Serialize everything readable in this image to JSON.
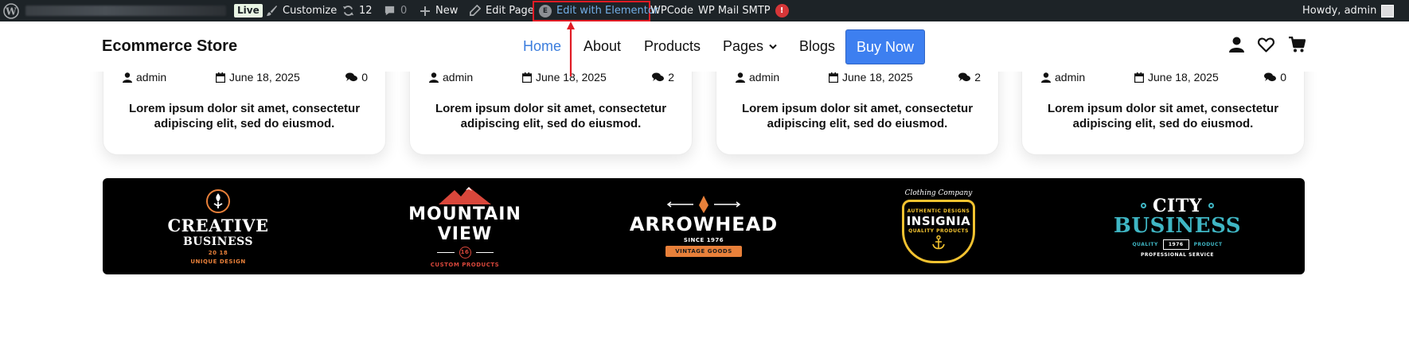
{
  "admin_bar": {
    "live_label": "Live",
    "customize_label": "Customize",
    "updates_count": "12",
    "comments_count": "0",
    "new_label": "New",
    "edit_page_label": "Edit Page",
    "elementor_label": "Edit with Elementor",
    "elementor_badge": "E",
    "wpcode_label": "WPCode",
    "smtp_label": "WP Mail SMTP",
    "smtp_badge": "!",
    "howdy_label": "Howdy, admin"
  },
  "header": {
    "brand": "Ecommerce Store",
    "nav": [
      "Home",
      "About",
      "Products",
      "Pages",
      "Blogs"
    ],
    "active_nav": "Home",
    "buy_button": "Buy Now"
  },
  "posts": [
    {
      "author": "admin",
      "date": "June 18, 2025",
      "comments": "0",
      "excerpt": "Lorem ipsum dolor sit amet, consectetur adipiscing elit, sed do eiusmod."
    },
    {
      "author": "admin",
      "date": "June 18, 2025",
      "comments": "2",
      "excerpt": "Lorem ipsum dolor sit amet, consectetur adipiscing elit, sed do eiusmod."
    },
    {
      "author": "admin",
      "date": "June 18, 2025",
      "comments": "2",
      "excerpt": "Lorem ipsum dolor sit amet, consectetur adipiscing elit, sed do eiusmod."
    },
    {
      "author": "admin",
      "date": "June 18, 2025",
      "comments": "0",
      "excerpt": "Lorem ipsum dolor sit amet, consectetur adipiscing elit, sed do eiusmod."
    }
  ],
  "brand_logos": [
    {
      "name": "CREATIVE",
      "line2": "BUSINESS",
      "line3": "20 18",
      "line4": "UNIQUE DESIGN"
    },
    {
      "name": "MOUNTAIN VIEW",
      "line2": "16",
      "line3": "CUSTOM PRODUCTS"
    },
    {
      "name": "ARROWHEAD",
      "line2": "SINCE 1976",
      "line3": "VINTAGE GOODS"
    },
    {
      "name": "INSIGNIA",
      "top": "Clothing Company",
      "line2": "AUTHENTIC DESIGNS",
      "line3": "QUALITY PRODUCTS"
    },
    {
      "name": "CITY",
      "line2": "BUSINESS",
      "left": "QUALITY",
      "badge": "1976",
      "right": "PRODUCT",
      "bottom": "PROFESSIONAL SERVICE"
    }
  ],
  "colors": {
    "admin_bar_bg": "#1d2327",
    "accent_blue": "#3b7ddd",
    "buy_button_bg": "#3d7ff0",
    "highlight_red": "#e01b24",
    "banner_bg": "#000000",
    "logo_orange": "#e8803a",
    "logo_red": "#d9473b",
    "logo_yellow": "#f2c230",
    "logo_teal": "#3fb6c4"
  },
  "icons": [
    "wordpress-icon",
    "brush-icon",
    "refresh-icon",
    "comment-icon",
    "plus-icon",
    "pencil-icon",
    "elementor-icon",
    "user-icon",
    "calendar-icon",
    "comments-icon",
    "account-icon",
    "heart-icon",
    "cart-icon",
    "chevron-down-icon"
  ]
}
